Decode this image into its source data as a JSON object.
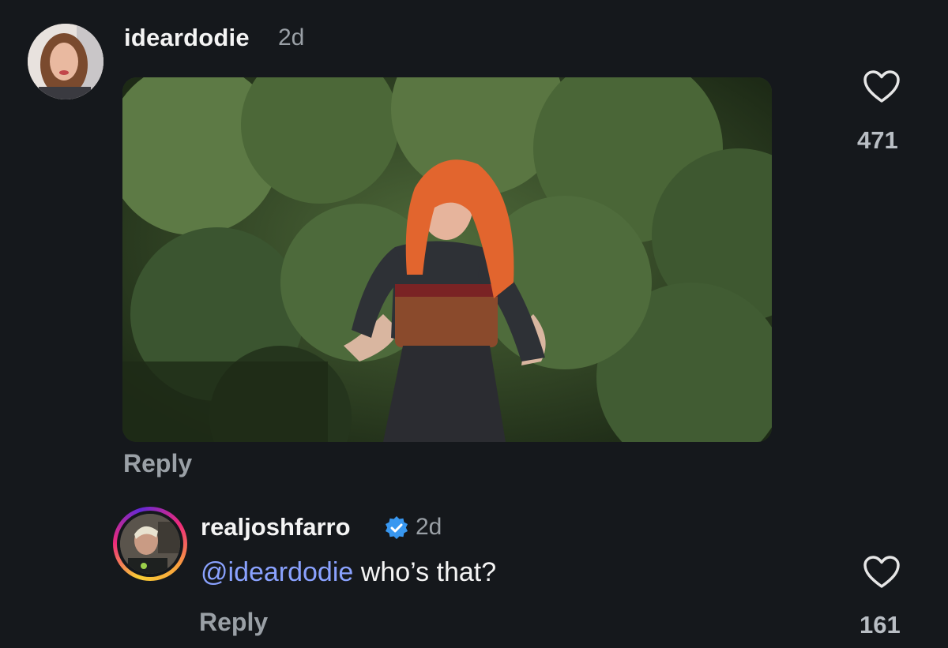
{
  "comments": [
    {
      "username": "ideardodie",
      "time": "2d",
      "reply_label": "Reply",
      "like_count": "471",
      "has_image": true,
      "image_description_icon": "photo-woman-red-hair"
    },
    {
      "username": "realjoshfarro",
      "verified": true,
      "time": "2d",
      "mention": "@ideardodie",
      "text": " who’s that?",
      "reply_label": "Reply",
      "like_count": "161"
    }
  ],
  "colors": {
    "background": "#15181c",
    "mention": "#8aa2ff",
    "verified_badge": "#3897f0",
    "secondary_text": "#9aa0a6"
  },
  "icons": {
    "like": "heart-outline-icon",
    "verified": "verified-badge-icon"
  }
}
